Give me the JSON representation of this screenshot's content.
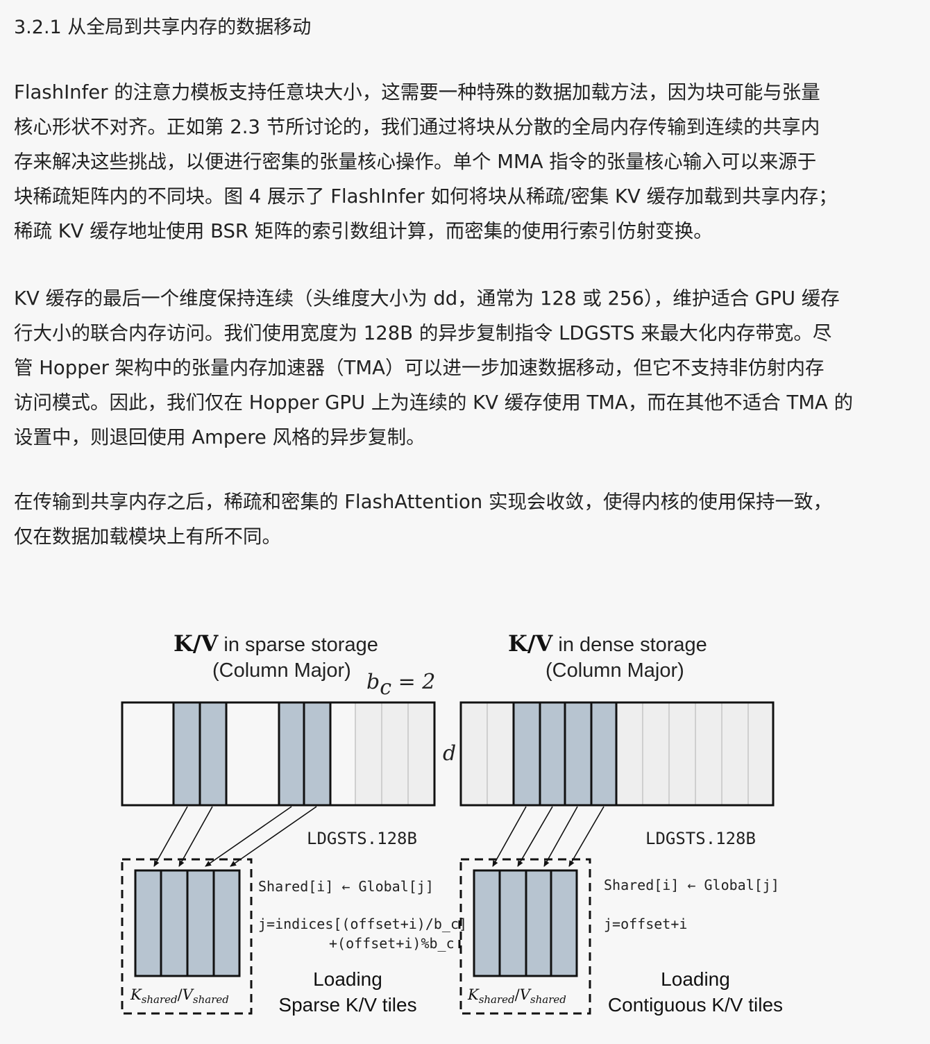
{
  "heading": "3.2.1 从全局到共享内存的数据移动",
  "paragraphs": {
    "p1": [
      "FlashInfer 的注意力模板支持任意块大小，这需要一种特殊的数据加载方法，因为块可能与张量",
      "核心形状不对齐。正如第 2.3 节所讨论的，我们通过将块从分散的全局内存传输到连续的共享内",
      "存来解决这些挑战，以便进行密集的张量核心操作。单个 MMA 指令的张量核心输入可以来源于",
      "块稀疏矩阵内的不同块。图 4 展示了 FlashInfer 如何将块从稀疏/密集 KV 缓存加载到共享内存；",
      "稀疏 KV 缓存地址使用 BSR 矩阵的索引数组计算，而密集的使用行索引仿射变换。"
    ],
    "p2": [
      "KV 缓存的最后一个维度保持连续（头维度大小为 dd，通常为 128 或 256），维护适合 GPU 缓存",
      "行大小的联合内存访问。我们使用宽度为 128B 的异步复制指令 LDGSTS 来最大化内存带宽。尽",
      "管 Hopper 架构中的张量内存加速器（TMA）可以进一步加速数据移动，但它不支持非仿射内存",
      "访问模式。因此，我们仅在 Hopper GPU 上为连续的 KV 缓存使用 TMA，而在其他不适合 TMA 的",
      "设置中，则退回使用 Ampere 风格的异步复制。"
    ],
    "p3": [
      "在传输到共享内存之后，稀疏和密集的 FlashAttention 实现会收敛，使得内核的使用保持一致，",
      "仅在数据加载模块上有所不同。"
    ]
  },
  "figure": {
    "left": {
      "title_bold": "K/V",
      "title_rest": " in sparse storage",
      "subtitle": "(Column Major)",
      "bc_label": "b",
      "bc_sub": "c",
      "bc_value": " = 2",
      "instr": "LDGSTS.128B",
      "code1": "Shared[i] ← Global[j]",
      "code2": "j=indices[(offset+i)/b_c]",
      "code3": "+(offset+i)%b_c",
      "caption1": "Loading",
      "caption2": "Sparse K/V tiles"
    },
    "right": {
      "title_bold": "K/V",
      "title_rest": " in dense storage",
      "subtitle": "(Column Major)",
      "instr": "LDGSTS.128B",
      "code1": "Shared[i] ← Global[j]",
      "code2": "j=offset+i",
      "caption1": "Loading",
      "caption2": "Contiguous K/V tiles"
    },
    "d_label": "d",
    "kshared": {
      "k": "K",
      "k_sub": "shared",
      "slash": "/",
      "v": "V",
      "v_sub": "shared"
    },
    "colors": {
      "shaded": "#b7c4d0",
      "light": "#eeeeee",
      "outline": "#111111"
    }
  }
}
